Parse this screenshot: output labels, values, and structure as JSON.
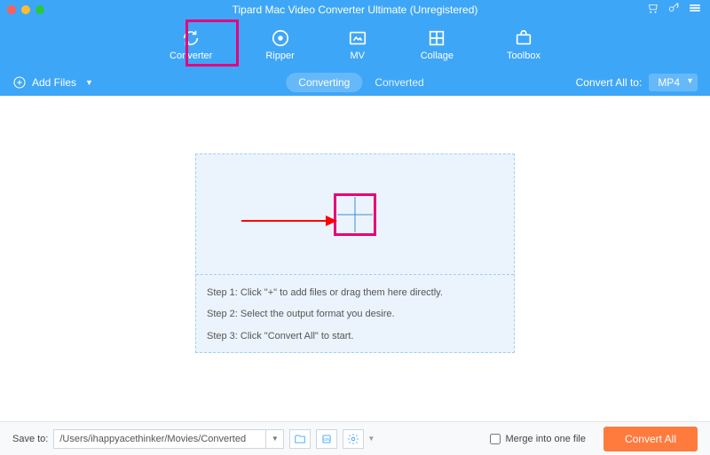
{
  "window": {
    "title": "Tipard Mac Video Converter Ultimate (Unregistered)"
  },
  "nav": {
    "converter": "Converter",
    "ripper": "Ripper",
    "mv": "MV",
    "collage": "Collage",
    "toolbox": "Toolbox"
  },
  "toolbar": {
    "add_files": "Add Files",
    "tab_converting": "Converting",
    "tab_converted": "Converted",
    "convert_all_to": "Convert All to:",
    "format": "MP4"
  },
  "steps": {
    "s1": "Step 1: Click \"+\" to add files or drag them here directly.",
    "s2": "Step 2: Select the output format you desire.",
    "s3": "Step 3: Click \"Convert All\" to start."
  },
  "bottom": {
    "save_to": "Save to:",
    "path": "/Users/ihappyacethinker/Movies/Converted",
    "merge": "Merge into one file",
    "convert_all": "Convert All"
  }
}
